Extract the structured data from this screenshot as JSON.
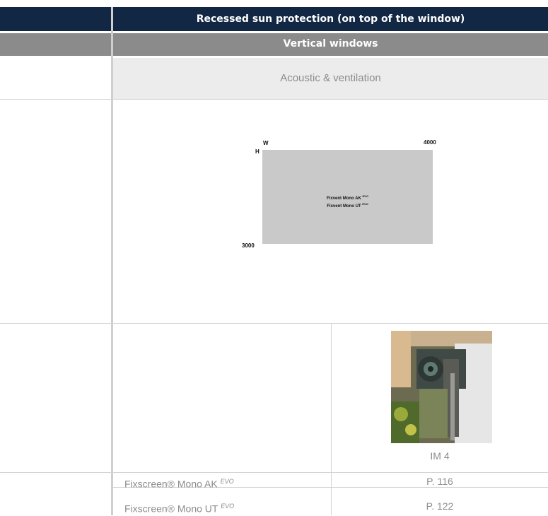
{
  "header": {
    "title": "Recessed sun protection (on top of the window)"
  },
  "subheader": {
    "title": "Vertical windows"
  },
  "category": {
    "title": "Acoustic & ventilation"
  },
  "diagram": {
    "w_label": "W",
    "w_max": "4000",
    "h_label": "H",
    "h_max": "3000",
    "line1": "Fixvent Mono AK",
    "line2": "Fixvent Mono UT",
    "suffix": "EVO",
    "box_color": "#c9c9c9"
  },
  "image": {
    "caption": "IM 4",
    "subject": "roller-shutter-cassette-photo"
  },
  "products": [
    {
      "name": "Fixscreen® Mono AK",
      "suffix": "EVO",
      "page": "P. 116"
    },
    {
      "name": "Fixscreen® Mono UT",
      "suffix": "EVO",
      "page": "P. 122"
    }
  ],
  "colors": {
    "navy": "#112744",
    "band_gray": "#8b8b8b",
    "light_band": "#ececec",
    "text_gray": "#8c8c8c"
  }
}
